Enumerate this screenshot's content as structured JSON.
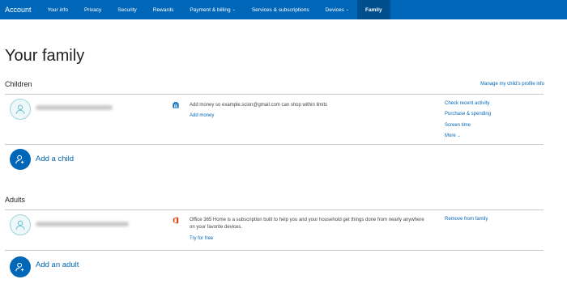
{
  "nav": {
    "brand": "Account",
    "items": [
      {
        "label": "Your info"
      },
      {
        "label": "Privacy"
      },
      {
        "label": "Security"
      },
      {
        "label": "Rewards"
      },
      {
        "label": "Payment & billing",
        "has_dropdown": true
      },
      {
        "label": "Services & subscriptions"
      },
      {
        "label": "Devices",
        "has_dropdown": true
      },
      {
        "label": "Family",
        "active": true
      }
    ]
  },
  "page_title": "Your family",
  "children": {
    "heading": "Children",
    "manage_link": "Manage my child's profile info",
    "member": {
      "service_text": "Add money so example.scion@gmail.com can shop within limits",
      "service_link": "Add money",
      "actions": [
        "Check recent activity",
        "Purchase & spending",
        "Screen time",
        "More"
      ]
    },
    "add_label": "Add a child"
  },
  "adults": {
    "heading": "Adults",
    "member": {
      "service_text_line1": "Office 365 Home is a subscription built to help you and your household get things done from nearly anywhere",
      "service_text_line2": "on your favorite devices.",
      "service_link": "Try for free",
      "action": "Remove from family"
    },
    "add_label": "Add an adult"
  },
  "colors": {
    "nav_bg": "#0067b8",
    "nav_active_bg": "#004e8c",
    "link": "#0067b8",
    "avatar_border": "#9ed4dc",
    "office_red": "#d83b01"
  }
}
